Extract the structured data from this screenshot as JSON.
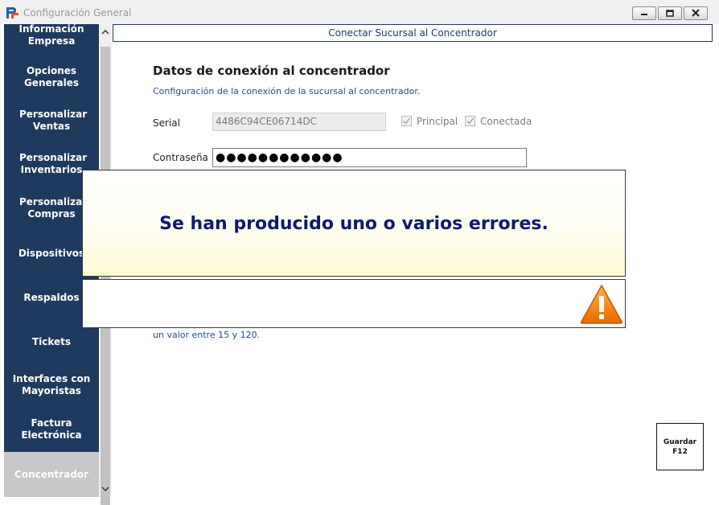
{
  "window": {
    "title": "Configuración General"
  },
  "sidebar": {
    "items": [
      {
        "label": "Información Empresa"
      },
      {
        "label": "Opciones Generales"
      },
      {
        "label": "Personalizar Ventas"
      },
      {
        "label": "Personalizar Inventarios"
      },
      {
        "label": "Personalizar Compras"
      },
      {
        "label": "Dispositivos"
      },
      {
        "label": "Respaldos"
      },
      {
        "label": "Tickets"
      },
      {
        "label": "Interfaces con Mayoristas"
      },
      {
        "label": "Factura Electrónica"
      },
      {
        "label": "Concentrador"
      }
    ],
    "active": "Concentrador"
  },
  "header": {
    "title": "Conectar Sucursal al Concentrador"
  },
  "form": {
    "section_title": "Datos de conexión al concentrador",
    "section_subtitle": "Configuración de la conexión de la sucursal al concentrador.",
    "serial_label": "Serial",
    "serial_value": "4486C94CE06714DC",
    "principal_label": "Principal",
    "principal_checked": true,
    "conectada_label": "Conectada",
    "conectada_checked": true,
    "password_label": "Contraseña",
    "password_value": "●●●●●●●●●●●●",
    "hint_text": "un valor entre 15 y 120."
  },
  "error_dialog": {
    "message": "Se han producido uno o varios errores.",
    "icon": "warning-icon"
  },
  "save_button": {
    "line1": "Guardar",
    "line2": "F12"
  },
  "colors": {
    "sidebar_bg": "#1f3a5f",
    "accent_text": "#1f4e8a",
    "error_text": "#0d1b6e",
    "warning": "#f08a12"
  }
}
